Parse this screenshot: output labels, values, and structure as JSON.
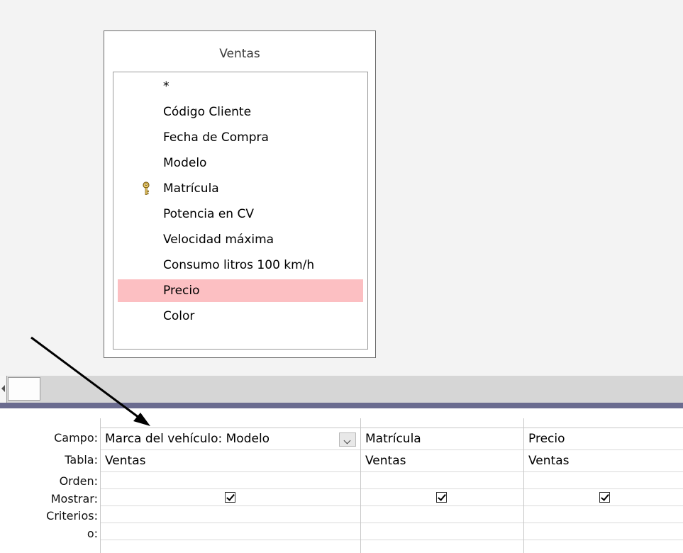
{
  "table": {
    "title": "Ventas",
    "fields": [
      {
        "label": "*",
        "key": false,
        "selected": false
      },
      {
        "label": "Código Cliente",
        "key": false,
        "selected": false
      },
      {
        "label": "Fecha de Compra",
        "key": false,
        "selected": false
      },
      {
        "label": "Modelo",
        "key": false,
        "selected": false
      },
      {
        "label": "Matrícula",
        "key": true,
        "selected": false
      },
      {
        "label": "Potencia en CV",
        "key": false,
        "selected": false
      },
      {
        "label": "Velocidad máxima",
        "key": false,
        "selected": false
      },
      {
        "label": "Consumo litros 100 km/h",
        "key": false,
        "selected": false
      },
      {
        "label": "Precio",
        "key": false,
        "selected": true
      },
      {
        "label": "Color",
        "key": false,
        "selected": false
      }
    ],
    "key_icon": "key-icon"
  },
  "grid": {
    "row_labels": [
      "Campo:",
      "Tabla:",
      "Orden:",
      "Mostrar:",
      "Criterios:",
      "o:"
    ],
    "columns": [
      {
        "campo": "Marca del vehículo: Modelo",
        "tabla": "Ventas",
        "orden": "",
        "mostrar": true,
        "criterios": "",
        "o": "",
        "has_dropdown": true
      },
      {
        "campo": "Matrícula",
        "tabla": "Ventas",
        "orden": "",
        "mostrar": true,
        "criterios": "",
        "o": "",
        "has_dropdown": false
      },
      {
        "campo": "Precio",
        "tabla": "Ventas",
        "orden": "",
        "mostrar": true,
        "criterios": "",
        "o": "",
        "has_dropdown": false
      }
    ]
  },
  "colors": {
    "selected_field": "#fcbfc2",
    "splitter": "#6a6b8f",
    "pane_background": "#f3f3f3"
  },
  "annotation": {
    "type": "arrow",
    "color": "#000000"
  }
}
